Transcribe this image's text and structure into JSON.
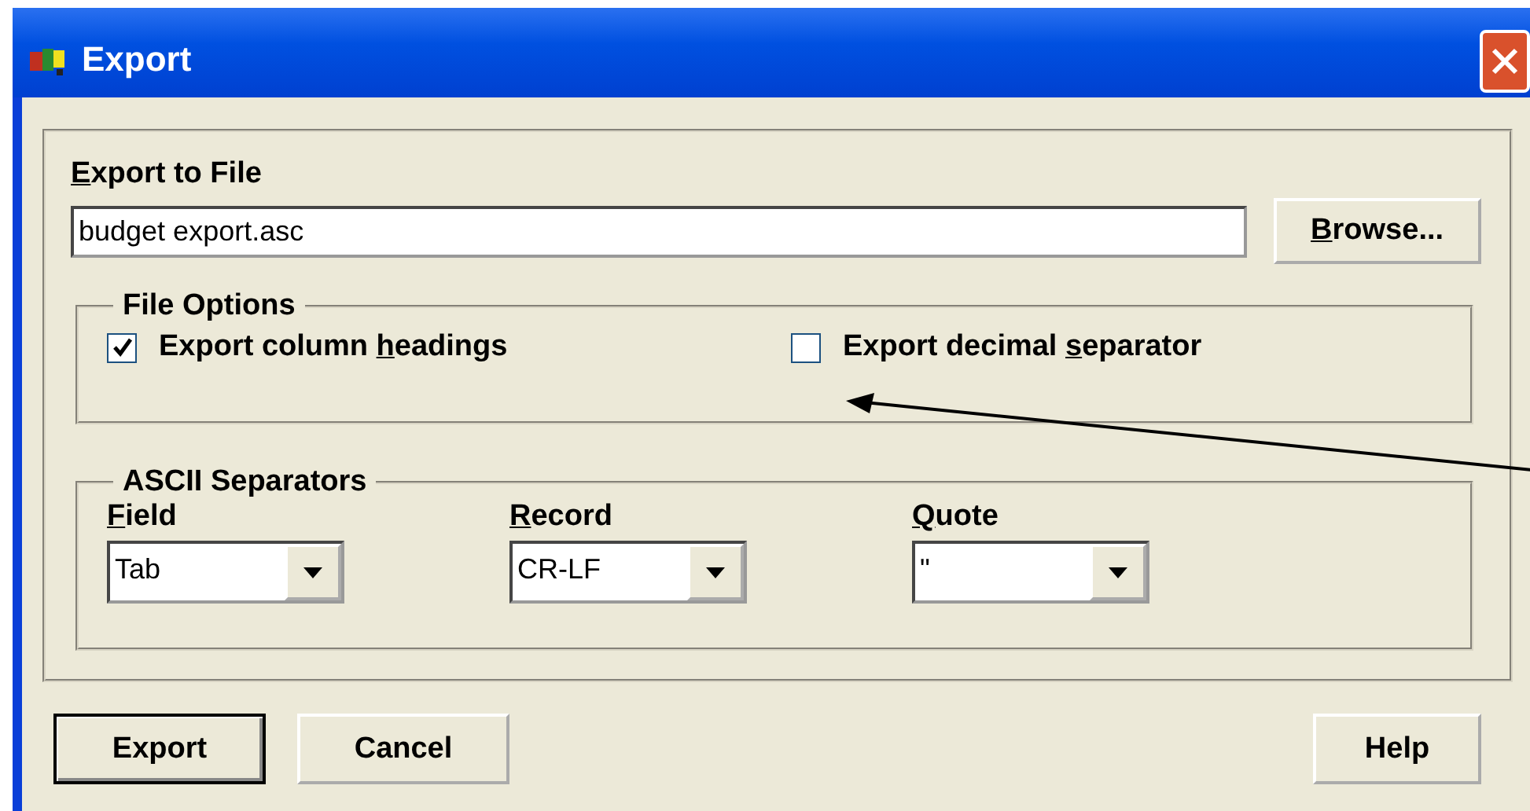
{
  "window": {
    "title": "Export"
  },
  "export_to_file": {
    "label": {
      "key": "E",
      "post": "xport to File"
    },
    "value": "budget export.asc"
  },
  "browse_button": {
    "label": {
      "key": "B",
      "post": "rowse..."
    }
  },
  "file_options": {
    "title": "File Options",
    "options": [
      {
        "label": {
          "pre": "Export column ",
          "key": "h",
          "post": "eadings"
        },
        "checked": true
      },
      {
        "label": {
          "pre": "Export decimal ",
          "key": "s",
          "post": "eparator"
        },
        "checked": false
      }
    ]
  },
  "ascii_separators": {
    "title": "ASCII Separators",
    "fields": [
      {
        "label": {
          "key": "F",
          "post": "ield"
        },
        "value": "Tab"
      },
      {
        "label": {
          "key": "R",
          "post": "ecord"
        },
        "value": "CR-LF"
      },
      {
        "label": {
          "key": "Q",
          "post": "uote"
        },
        "value": "\""
      }
    ]
  },
  "buttons_left": [
    {
      "label": "Export",
      "default": true
    },
    {
      "label": "Cancel",
      "default": false
    }
  ],
  "buttons_right": [
    {
      "label": "Help",
      "default": false
    }
  ]
}
